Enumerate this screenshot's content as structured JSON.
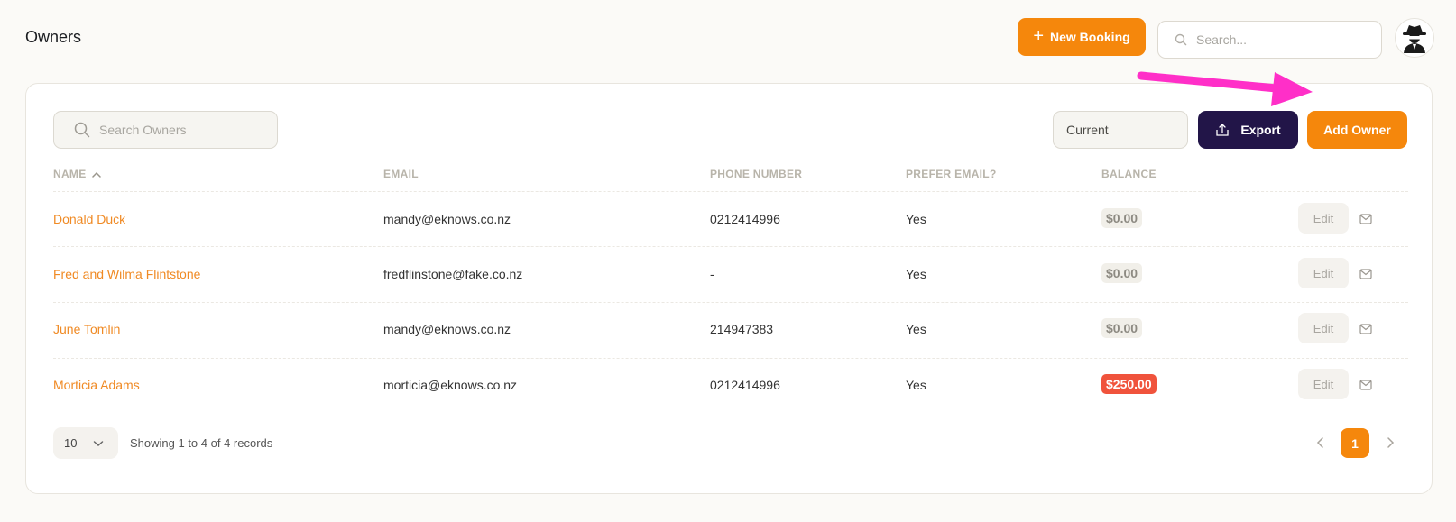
{
  "header": {
    "title": "Owners",
    "new_booking_label": "New Booking",
    "search_placeholder": "Search..."
  },
  "toolbar": {
    "search_placeholder": "Search Owners",
    "status_value": "Current",
    "export_label": "Export",
    "add_owner_label": "Add Owner"
  },
  "table": {
    "columns": [
      "NAME",
      "EMAIL",
      "PHONE NUMBER",
      "PREFER EMAIL?",
      "BALANCE"
    ],
    "sort": {
      "column": "NAME",
      "direction": "ascending"
    },
    "edit_label": "Edit",
    "rows": [
      {
        "name": "Donald Duck",
        "email": "mandy@eknows.co.nz",
        "phone": "0212414996",
        "prefer_email": "Yes",
        "balance": "$0.00",
        "balance_status": "zero"
      },
      {
        "name": "Fred and Wilma Flintstone",
        "email": "fredflinstone@fake.co.nz",
        "phone": "-",
        "prefer_email": "Yes",
        "balance": "$0.00",
        "balance_status": "zero"
      },
      {
        "name": "June Tomlin",
        "email": "mandy@eknows.co.nz",
        "phone": "214947383",
        "prefer_email": "Yes",
        "balance": "$0.00",
        "balance_status": "zero"
      },
      {
        "name": "Morticia Adams",
        "email": "morticia@eknows.co.nz",
        "phone": "0212414996",
        "prefer_email": "Yes",
        "balance": "$250.00",
        "balance_status": "owing"
      }
    ]
  },
  "footer": {
    "page_size": "10",
    "showing_text": "Showing 1 to 4 of 4 records",
    "current_page": "1"
  },
  "colors": {
    "accent": "#f5870c",
    "export": "#221548",
    "owing": "#f0533c",
    "annotation_arrow": "#ff2fc8"
  }
}
